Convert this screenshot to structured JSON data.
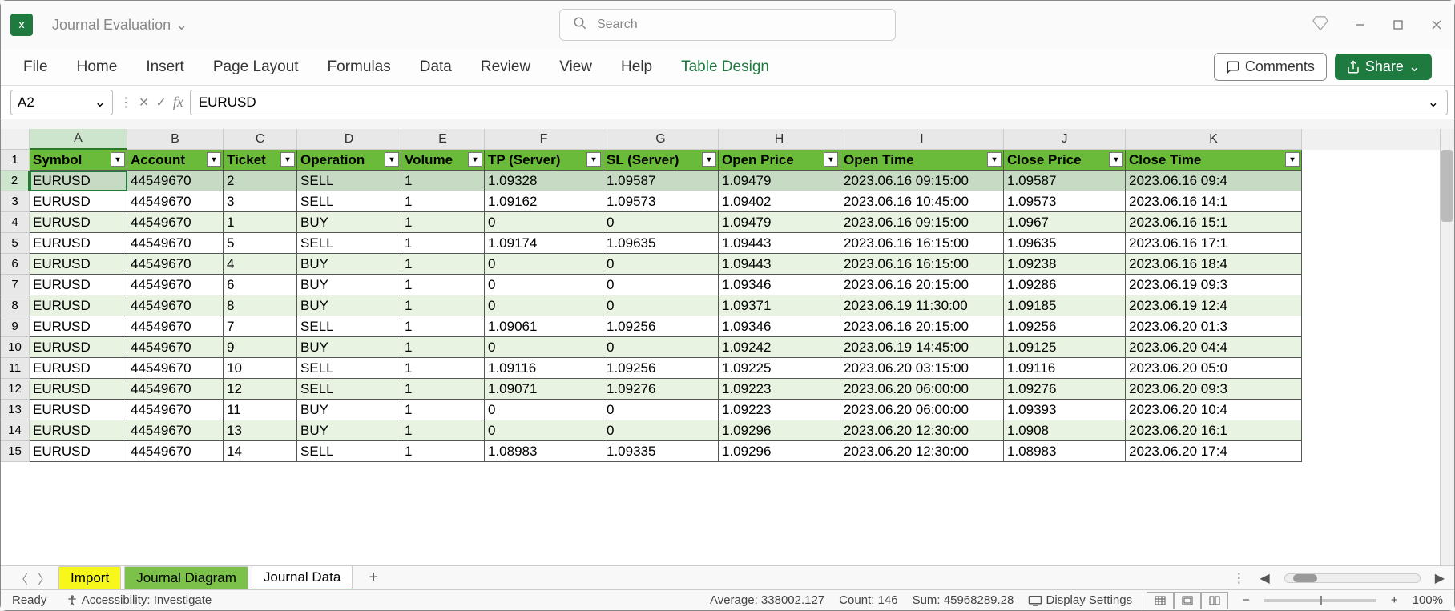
{
  "title": {
    "doc_name": "Journal Evaluation"
  },
  "search": {
    "placeholder": "Search"
  },
  "ribbon": {
    "tabs": [
      "File",
      "Home",
      "Insert",
      "Page Layout",
      "Formulas",
      "Data",
      "Review",
      "View",
      "Help",
      "Table Design"
    ],
    "comments": "Comments",
    "share": "Share"
  },
  "formula_bar": {
    "name_box": "A2",
    "fx": "fx",
    "value": "EURUSD"
  },
  "columns": [
    "A",
    "B",
    "C",
    "D",
    "E",
    "F",
    "G",
    "H",
    "I",
    "J",
    "K"
  ],
  "headers": [
    "Symbol",
    "Account",
    "Ticket",
    "Operation",
    "Volume",
    "TP (Server)",
    "SL (Server)",
    "Open Price",
    "Open Time",
    "Close Price",
    "Close Time"
  ],
  "rows": [
    [
      "EURUSD",
      "44549670",
      "2",
      "SELL",
      "1",
      "1.09328",
      "1.09587",
      "1.09479",
      "2023.06.16 09:15:00",
      "1.09587",
      "2023.06.16 09:4"
    ],
    [
      "EURUSD",
      "44549670",
      "3",
      "SELL",
      "1",
      "1.09162",
      "1.09573",
      "1.09402",
      "2023.06.16 10:45:00",
      "1.09573",
      "2023.06.16 14:1"
    ],
    [
      "EURUSD",
      "44549670",
      "1",
      "BUY",
      "1",
      "0",
      "0",
      "1.09479",
      "2023.06.16 09:15:00",
      "1.0967",
      "2023.06.16 15:1"
    ],
    [
      "EURUSD",
      "44549670",
      "5",
      "SELL",
      "1",
      "1.09174",
      "1.09635",
      "1.09443",
      "2023.06.16 16:15:00",
      "1.09635",
      "2023.06.16 17:1"
    ],
    [
      "EURUSD",
      "44549670",
      "4",
      "BUY",
      "1",
      "0",
      "0",
      "1.09443",
      "2023.06.16 16:15:00",
      "1.09238",
      "2023.06.16 18:4"
    ],
    [
      "EURUSD",
      "44549670",
      "6",
      "BUY",
      "1",
      "0",
      "0",
      "1.09346",
      "2023.06.16 20:15:00",
      "1.09286",
      "2023.06.19 09:3"
    ],
    [
      "EURUSD",
      "44549670",
      "8",
      "BUY",
      "1",
      "0",
      "0",
      "1.09371",
      "2023.06.19 11:30:00",
      "1.09185",
      "2023.06.19 12:4"
    ],
    [
      "EURUSD",
      "44549670",
      "7",
      "SELL",
      "1",
      "1.09061",
      "1.09256",
      "1.09346",
      "2023.06.16 20:15:00",
      "1.09256",
      "2023.06.20 01:3"
    ],
    [
      "EURUSD",
      "44549670",
      "9",
      "BUY",
      "1",
      "0",
      "0",
      "1.09242",
      "2023.06.19 14:45:00",
      "1.09125",
      "2023.06.20 04:4"
    ],
    [
      "EURUSD",
      "44549670",
      "10",
      "SELL",
      "1",
      "1.09116",
      "1.09256",
      "1.09225",
      "2023.06.20 03:15:00",
      "1.09116",
      "2023.06.20 05:0"
    ],
    [
      "EURUSD",
      "44549670",
      "12",
      "SELL",
      "1",
      "1.09071",
      "1.09276",
      "1.09223",
      "2023.06.20 06:00:00",
      "1.09276",
      "2023.06.20 09:3"
    ],
    [
      "EURUSD",
      "44549670",
      "11",
      "BUY",
      "1",
      "0",
      "0",
      "1.09223",
      "2023.06.20 06:00:00",
      "1.09393",
      "2023.06.20 10:4"
    ],
    [
      "EURUSD",
      "44549670",
      "13",
      "BUY",
      "1",
      "0",
      "0",
      "1.09296",
      "2023.06.20 12:30:00",
      "1.0908",
      "2023.06.20 16:1"
    ],
    [
      "EURUSD",
      "44549670",
      "14",
      "SELL",
      "1",
      "1.08983",
      "1.09335",
      "1.09296",
      "2023.06.20 12:30:00",
      "1.08983",
      "2023.06.20 17:4"
    ]
  ],
  "sheet_tabs": {
    "import": "Import",
    "diagram": "Journal Diagram",
    "data": "Journal Data"
  },
  "status": {
    "ready": "Ready",
    "accessibility": "Accessibility: Investigate",
    "average_label": "Average:",
    "average_val": "338002.127",
    "count_label": "Count:",
    "count_val": "146",
    "sum_label": "Sum:",
    "sum_val": "45968289.28",
    "display": "Display Settings",
    "zoom": "100%"
  }
}
